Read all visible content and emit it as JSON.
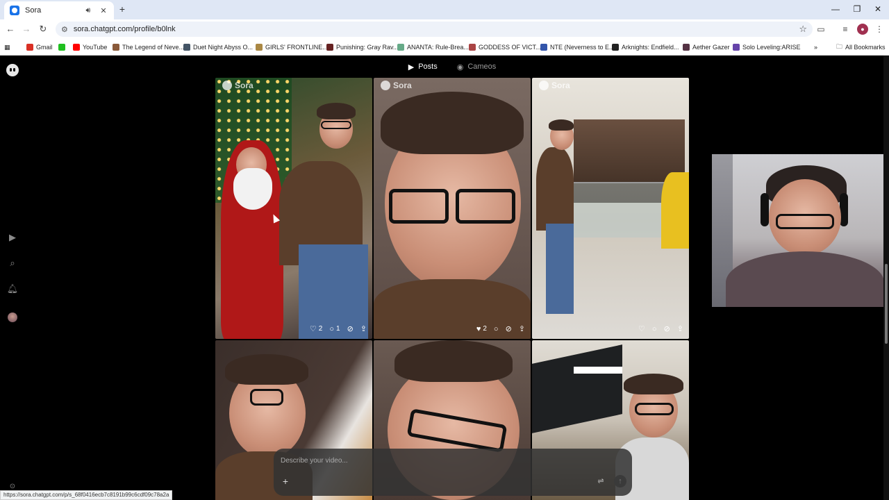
{
  "browser": {
    "tab_title": "Sora",
    "url": "sora.chatgpt.com/profile/b0lnk",
    "bookmarks": [
      {
        "label": "Gmail",
        "color": "#d93025"
      },
      {
        "label": "",
        "color": "#20c020"
      },
      {
        "label": "YouTube",
        "color": "#ff0000"
      },
      {
        "label": "The Legend of Neve...",
        "color": "#8a5a3a"
      },
      {
        "label": "Duet Night Abyss O...",
        "color": "#445566"
      },
      {
        "label": "GIRLS' FRONTLINE...",
        "color": "#aa8844"
      },
      {
        "label": "Punishing: Gray Rav...",
        "color": "#662222"
      },
      {
        "label": "ANANTA: Rule-Brea...",
        "color": "#66aa88"
      },
      {
        "label": "GODDESS OF VICT...",
        "color": "#aa4444"
      },
      {
        "label": "NTE (Neverness to E...",
        "color": "#3355aa"
      },
      {
        "label": "Arknights: Endfield...",
        "color": "#222222"
      },
      {
        "label": "Aether Gazer",
        "color": "#553344"
      },
      {
        "label": "Solo Leveling:ARISE",
        "color": "#6644aa"
      }
    ],
    "all_bookmarks_label": "All Bookmarks",
    "status_url": "https://sora.chatgpt.com/p/s_68f0416ecb7c8191b99c6cdf09c78a2a"
  },
  "profile_tabs": [
    {
      "label": "Posts",
      "active": true
    },
    {
      "label": "Cameos",
      "active": false
    }
  ],
  "watermark": "Sora",
  "posts": [
    {
      "likes": "2",
      "comments": "1",
      "liked": false
    },
    {
      "likes": "2",
      "comments": "",
      "liked": true
    },
    {
      "likes": "",
      "comments": "",
      "liked": false
    },
    {
      "likes": "",
      "comments": "",
      "liked": false
    },
    {
      "likes": "",
      "comments": "",
      "liked": false
    },
    {
      "likes": "",
      "comments": "",
      "liked": false
    }
  ],
  "composer": {
    "placeholder": "Describe your video..."
  },
  "colors": {
    "page_bg": "#000000",
    "browser_chrome": "#dfe7f5"
  }
}
